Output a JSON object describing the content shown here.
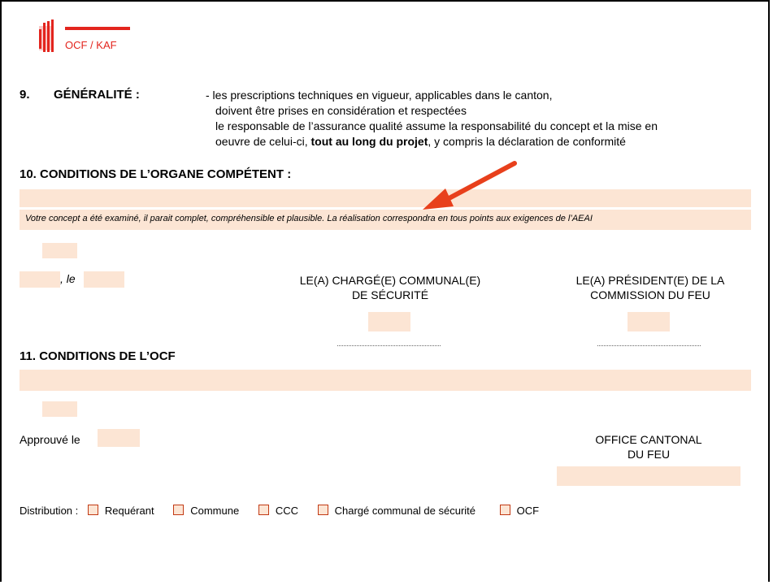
{
  "header": {
    "logo_text": "OCF / KAF",
    "brand_color": "#e3251e"
  },
  "section9": {
    "number": "9.",
    "title": "GÉNÉRALITÉ :",
    "line1": "- les prescriptions techniques en vigueur, applicables dans le canton,",
    "line2": "doivent être prises en considération et respectées",
    "line3": "le responsable de l’assurance qualité assume la responsabilité du concept et la mise en",
    "line4_a": "oeuvre de celui-ci, ",
    "line4_b": "tout au long du projet",
    "line4_c": ", y compris la déclaration de conformité"
  },
  "section10": {
    "title": "10.  CONDITIONS DE L’ORGANE COMPÉTENT :",
    "note": "Votre concept a été examiné, il parait complet, compréhensible et plausible. La réalisation correspondra en tous points aux exigences de l’AEAI",
    "place_suffix": ", le",
    "sig1_line1": "LE(A) CHARGÉ(E) COMMUNAL(E)",
    "sig1_line2": "DE SÉCURITÉ",
    "sig2_line1": "LE(A) PRÉSIDENT(E) DE LA",
    "sig2_line2": "COMMISSION DU FEU"
  },
  "section11": {
    "title": "11.  CONDITIONS DE L’OCF",
    "approved_label": "Approuvé le",
    "office_line1": "OFFICE CANTONAL",
    "office_line2": "DU FEU"
  },
  "distribution": {
    "label": "Distribution :",
    "options": [
      "Requérant",
      "Commune",
      "CCC",
      "Chargé communal de sécurité",
      "OCF"
    ]
  },
  "colors": {
    "field": "#fce5d4",
    "arrow": "#e8401c"
  }
}
